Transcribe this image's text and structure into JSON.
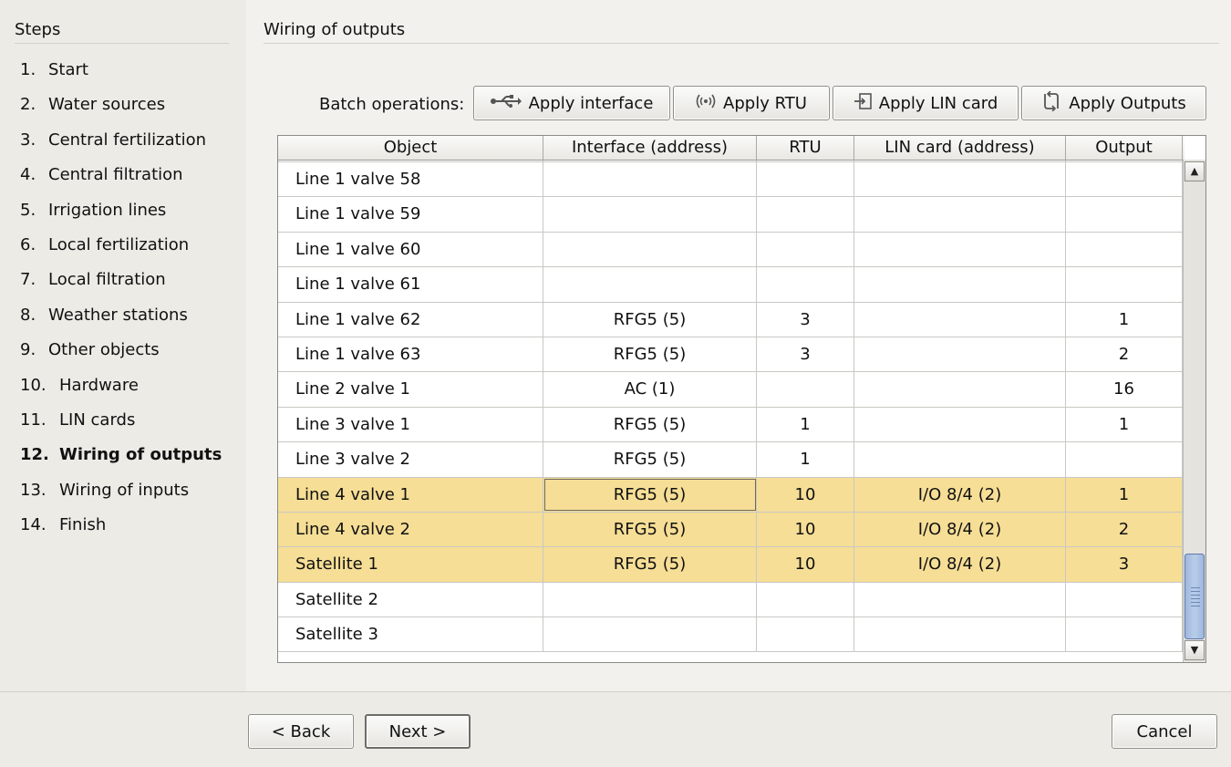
{
  "sidebar": {
    "title": "Steps",
    "steps": [
      {
        "num": "1.",
        "label": "Start"
      },
      {
        "num": "2.",
        "label": "Water sources"
      },
      {
        "num": "3.",
        "label": "Central fertilization"
      },
      {
        "num": "4.",
        "label": "Central filtration"
      },
      {
        "num": "5.",
        "label": "Irrigation lines"
      },
      {
        "num": "6.",
        "label": "Local fertilization"
      },
      {
        "num": "7.",
        "label": "Local filtration"
      },
      {
        "num": "8.",
        "label": "Weather stations"
      },
      {
        "num": "9.",
        "label": "Other objects"
      },
      {
        "num": "10.",
        "label": "Hardware"
      },
      {
        "num": "11.",
        "label": "LIN cards"
      },
      {
        "num": "12.",
        "label": "Wiring of outputs",
        "active": true
      },
      {
        "num": "13.",
        "label": "Wiring of inputs"
      },
      {
        "num": "14.",
        "label": "Finish"
      }
    ]
  },
  "main": {
    "title": "Wiring of outputs",
    "batch_label": "Batch operations:",
    "batch_buttons": [
      {
        "label": "Apply interface",
        "icon": "usb-icon"
      },
      {
        "label": "Apply RTU",
        "icon": "radio-signal-icon"
      },
      {
        "label": "Apply LIN card",
        "icon": "card-insert-icon"
      },
      {
        "label": "Apply Outputs",
        "icon": "outputs-swap-icon"
      }
    ],
    "table": {
      "columns": [
        "Object",
        "Interface (address)",
        "RTU",
        "LIN card (address)",
        "Output"
      ],
      "partial_top_row": [
        "",
        "",
        "",
        "",
        ""
      ],
      "rows": [
        {
          "object": "Line 1 valve 58",
          "interface": "",
          "rtu": "",
          "lin": "",
          "output": ""
        },
        {
          "object": "Line 1 valve 59",
          "interface": "",
          "rtu": "",
          "lin": "",
          "output": ""
        },
        {
          "object": "Line 1 valve 60",
          "interface": "",
          "rtu": "",
          "lin": "",
          "output": ""
        },
        {
          "object": "Line 1 valve 61",
          "interface": "",
          "rtu": "",
          "lin": "",
          "output": ""
        },
        {
          "object": "Line 1 valve 62",
          "interface": "RFG5 (5)",
          "rtu": "3",
          "lin": "",
          "output": "1"
        },
        {
          "object": "Line 1 valve 63",
          "interface": "RFG5 (5)",
          "rtu": "3",
          "lin": "",
          "output": "2"
        },
        {
          "object": "Line 2 valve 1",
          "interface": "AC (1)",
          "rtu": "",
          "lin": "",
          "output": "16"
        },
        {
          "object": "Line 3 valve 1",
          "interface": "RFG5 (5)",
          "rtu": "1",
          "lin": "",
          "output": "1"
        },
        {
          "object": "Line 3 valve 2",
          "interface": "RFG5 (5)",
          "rtu": "1",
          "lin": "",
          "output": ""
        },
        {
          "object": "Line 4 valve 1",
          "interface": "RFG5 (5)",
          "rtu": "10",
          "lin": "I/O 8/4 (2)",
          "output": "1",
          "selected": true,
          "focus_interface": true
        },
        {
          "object": "Line 4 valve 2",
          "interface": "RFG5 (5)",
          "rtu": "10",
          "lin": "I/O 8/4 (2)",
          "output": "2",
          "selected": true
        },
        {
          "object": "Satellite 1",
          "interface": "RFG5 (5)",
          "rtu": "10",
          "lin": "I/O 8/4 (2)",
          "output": "3",
          "selected": true
        },
        {
          "object": "Satellite 2",
          "interface": "",
          "rtu": "",
          "lin": "",
          "output": ""
        },
        {
          "object": "Satellite 3",
          "interface": "",
          "rtu": "",
          "lin": "",
          "output": ""
        }
      ],
      "selection_color": "#f6de96",
      "scroll_position": 0.92
    }
  },
  "footer": {
    "back_label": "< Back",
    "next_label": "Next >",
    "cancel_label": "Cancel"
  }
}
